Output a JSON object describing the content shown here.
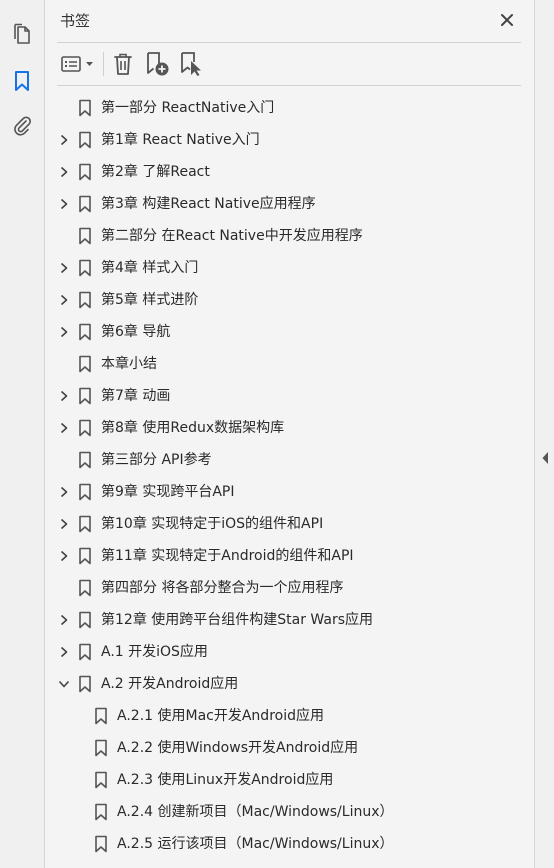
{
  "panel": {
    "title": "书签"
  },
  "toolbar": {
    "options_icon": "options-menu-icon",
    "delete_icon": "trash-icon",
    "new_bookmark_icon": "new-bookmark-icon",
    "find_bookmark_icon": "find-current-bookmark-icon"
  },
  "rail": {
    "items": [
      "pages-icon",
      "bookmark-icon",
      "attachment-icon"
    ],
    "active": "bookmark-icon"
  },
  "colors": {
    "accent": "#1473e6",
    "icon": "#555555",
    "background": "#f4f4f4"
  },
  "bookmarks": [
    {
      "label": "第一部分 ReactNative入门",
      "level": 0,
      "expander": "none"
    },
    {
      "label": "第1章 React Native入门",
      "level": 0,
      "expander": "collapsed"
    },
    {
      "label": "第2章 了解React",
      "level": 0,
      "expander": "collapsed"
    },
    {
      "label": "第3章 构建React Native应用程序",
      "level": 0,
      "expander": "collapsed"
    },
    {
      "label": "第二部分 在React Native中开发应用程序",
      "level": 0,
      "expander": "none"
    },
    {
      "label": "第4章 样式入门",
      "level": 0,
      "expander": "collapsed"
    },
    {
      "label": "第5章 样式进阶",
      "level": 0,
      "expander": "collapsed"
    },
    {
      "label": "第6章 导航",
      "level": 0,
      "expander": "collapsed"
    },
    {
      "label": "本章小结",
      "level": 0,
      "expander": "none"
    },
    {
      "label": "第7章 动画",
      "level": 0,
      "expander": "collapsed"
    },
    {
      "label": "第8章 使用Redux数据架构库",
      "level": 0,
      "expander": "collapsed"
    },
    {
      "label": "第三部分 API参考",
      "level": 0,
      "expander": "none"
    },
    {
      "label": "第9章 实现跨平台API",
      "level": 0,
      "expander": "collapsed"
    },
    {
      "label": "第10章 实现特定于iOS的组件和API",
      "level": 0,
      "expander": "collapsed"
    },
    {
      "label": "第11章 实现特定于Android的组件和API",
      "level": 0,
      "expander": "collapsed"
    },
    {
      "label": "第四部分 将各部分整合为一个应用程序",
      "level": 0,
      "expander": "none"
    },
    {
      "label": "第12章 使用跨平台组件构建Star Wars应用",
      "level": 0,
      "expander": "collapsed"
    },
    {
      "label": "A.1 开发iOS应用",
      "level": 0,
      "expander": "collapsed"
    },
    {
      "label": "A.2 开发Android应用",
      "level": 0,
      "expander": "expanded"
    },
    {
      "label": "A.2.1 使用Mac开发Android应用",
      "level": 1,
      "expander": "none"
    },
    {
      "label": "A.2.2 使用Windows开发Android应用",
      "level": 1,
      "expander": "none"
    },
    {
      "label": "A.2.3 使用Linux开发Android应用",
      "level": 1,
      "expander": "none"
    },
    {
      "label": "A.2.4 创建新项目（Mac/Windows/Linux）",
      "level": 1,
      "expander": "none"
    },
    {
      "label": "A.2.5 运行该项目（Mac/Windows/Linux）",
      "level": 1,
      "expander": "none"
    }
  ]
}
